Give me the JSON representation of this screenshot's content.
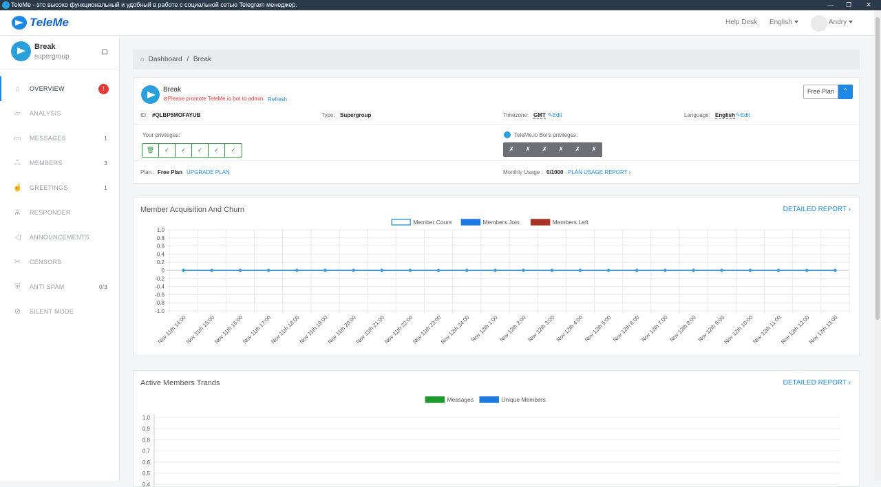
{
  "window": {
    "title": "TeleMe - это высоко функциональный и удобный в работе с социальной сетью Telegram менеджер."
  },
  "topbar": {
    "brand": "TeleMe",
    "help": "Help Desk",
    "language": "English",
    "user": "Andry"
  },
  "sidebar": {
    "group_name": "Break",
    "group_type": "supergroup",
    "items": [
      {
        "label": "OVERVIEW",
        "icon": "home-icon",
        "count": "!",
        "active": true
      },
      {
        "label": "ANALYSIS",
        "icon": "chart-icon",
        "count": ""
      },
      {
        "label": "MESSAGES",
        "icon": "message-icon",
        "count": "1"
      },
      {
        "label": "MEMBERS",
        "icon": "users-icon",
        "count": "3"
      },
      {
        "label": "GREETINGS",
        "icon": "thumbs-up-icon",
        "count": "1"
      },
      {
        "label": "RESPONDER",
        "icon": "robot-icon",
        "count": ""
      },
      {
        "label": "ANNOUNCEMENTS",
        "icon": "megaphone-icon",
        "count": ""
      },
      {
        "label": "CENSORS",
        "icon": "scissors-icon",
        "count": ""
      },
      {
        "label": "ANTI SPAM",
        "icon": "shield-icon",
        "count": "0/3"
      },
      {
        "label": "SILENT MODE",
        "icon": "mute-icon",
        "count": ""
      }
    ]
  },
  "breadcrumb": {
    "home": "Dashboard",
    "sep": "/",
    "current": "Break"
  },
  "group_info": {
    "name": "Break",
    "warning": "Please promote TeleMe.io bot to admin.",
    "refresh": "Refresh",
    "id_label": "ID:",
    "id_value": "#QLBP5MOFAYUB",
    "type_label": "Type:",
    "type_value": "Supergroup",
    "tz_label": "Timezone:",
    "tz_value": "GMT",
    "edit": "Edit",
    "lang_label": "Language:",
    "lang_value": "English",
    "your_priv": "Your privileges:",
    "bot_priv": "TeleMe.io Bot's privileges:",
    "plan_label": "Plan :",
    "plan_value": "Free Plan",
    "upgrade": "UPGRADE PLAN",
    "usage_label": "Monthly Usage :",
    "usage_value": "0/1000",
    "usage_report": "PLAN USAGE REPORT",
    "plan_button": "Free Plan"
  },
  "chart_data": [
    {
      "type": "line",
      "title": "Member Acquisition And Churn",
      "detail_link": "DETAILED REPORT",
      "categories": [
        "Nov 11th 14:00",
        "Nov 11th 15:00",
        "Nov 11th 16:00",
        "Nov 11th 17:00",
        "Nov 11th 18:00",
        "Nov 11th 19:00",
        "Nov 11th 20:00",
        "Nov 11th 21:00",
        "Nov 11th 22:00",
        "Nov 11th 23:00",
        "Nov 12th 24:00",
        "Nov 12th 1:00",
        "Nov 12th 2:00",
        "Nov 12th 3:00",
        "Nov 12th 4:00",
        "Nov 12th 5:00",
        "Nov 12th 6:00",
        "Nov 12th 7:00",
        "Nov 12th 8:00",
        "Nov 12th 9:00",
        "Nov 12th 10:00",
        "Nov 12th 11:00",
        "Nov 12th 12:00",
        "Nov 12th 13:00"
      ],
      "series": [
        {
          "name": "Member Count",
          "color": "#ffffff",
          "border": "#3aa0dc",
          "values": [
            0,
            0,
            0,
            0,
            0,
            0,
            0,
            0,
            0,
            0,
            0,
            0,
            0,
            0,
            0,
            0,
            0,
            0,
            0,
            0,
            0,
            0,
            0,
            0
          ]
        },
        {
          "name": "Members Join",
          "color": "#1e7be0",
          "values": [
            0,
            0,
            0,
            0,
            0,
            0,
            0,
            0,
            0,
            0,
            0,
            0,
            0,
            0,
            0,
            0,
            0,
            0,
            0,
            0,
            0,
            0,
            0,
            0
          ]
        },
        {
          "name": "Members Left",
          "color": "#a83226",
          "values": [
            0,
            0,
            0,
            0,
            0,
            0,
            0,
            0,
            0,
            0,
            0,
            0,
            0,
            0,
            0,
            0,
            0,
            0,
            0,
            0,
            0,
            0,
            0,
            0
          ]
        }
      ],
      "yticks": [
        "1.0",
        "0.8",
        "0.6",
        "0.4",
        "0.2",
        "0",
        "-0.2",
        "-0.4",
        "-0.6",
        "-0.8",
        "-1.0"
      ],
      "ylim": [
        -1,
        1
      ],
      "grid": true,
      "legend": "top-center"
    },
    {
      "type": "bar",
      "title": "Active Members Trands",
      "detail_link": "DETAILED REPORT",
      "series": [
        {
          "name": "Messages",
          "color": "#1f9a2e",
          "values": []
        },
        {
          "name": "Unique Members",
          "color": "#1e7be0",
          "values": []
        }
      ],
      "yticks": [
        "1.0",
        "0.9",
        "0.8",
        "0.7",
        "0.6",
        "0.5",
        "0.4"
      ],
      "ylim": [
        0,
        1
      ],
      "grid": true,
      "legend": "top-center"
    }
  ]
}
